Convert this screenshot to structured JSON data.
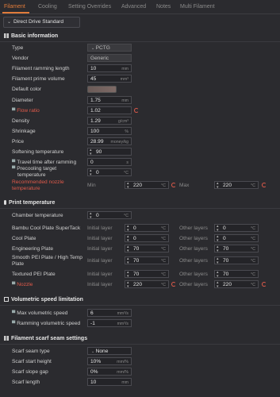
{
  "tabs": [
    "Filament",
    "Cooling",
    "Setting Overrides",
    "Advanced",
    "Notes",
    "Multi Filament"
  ],
  "preset": "Direct Drive Standard",
  "sections": {
    "basic": "Basic information",
    "print_temp": "Print temperature",
    "volumetric": "Volumetric speed limitation",
    "scarf": "Filament scarf seam settings"
  },
  "basic": {
    "type_label": "Type",
    "type_value": "PCTG",
    "vendor_label": "Vendor",
    "vendor_value": "Generic",
    "ramming_label": "Filament ramming length",
    "ramming_value": "10",
    "ramming_unit": "mm",
    "prime_label": "Filament prime volume",
    "prime_value": "45",
    "prime_unit": "mm³",
    "color_label": "Default color",
    "diameter_label": "Diameter",
    "diameter_value": "1.75",
    "diameter_unit": "mm",
    "flow_label": "Flow ratio",
    "flow_value": "1.02",
    "density_label": "Density",
    "density_value": "1.29",
    "density_unit": "g/cm³",
    "shrinkage_label": "Shrinkage",
    "shrinkage_value": "100",
    "shrinkage_unit": "%",
    "price_label": "Price",
    "price_value": "28.99",
    "price_unit": "money/kg",
    "soften_label": "Softening temperature",
    "soften_value": "90",
    "travel_label": "Travel time after ramming",
    "travel_value": "0",
    "travel_unit": "s",
    "precool_label_1": "Precooling target",
    "precool_label_2": "temperature",
    "precool_value": "0",
    "precool_unit": "°C",
    "nozzle_label_1": "Recommended nozzle",
    "nozzle_label_2": "temperature",
    "min_label": "Min",
    "min_value": "220",
    "min_unit": "°C",
    "max_label": "Max",
    "max_value": "220",
    "max_unit": "°C"
  },
  "temps": {
    "chamber_label": "Chamber temperature",
    "chamber_value": "0",
    "chamber_unit": "°C",
    "initial": "Initial layer",
    "other": "Other layers",
    "unit": "°C",
    "rows": [
      {
        "label": "Bambu Cool Plate SuperTack",
        "initial": "0",
        "other": "0"
      },
      {
        "label": "Cool Plate",
        "initial": "0",
        "other": "0"
      },
      {
        "label": "Engineering Plate",
        "initial": "70",
        "other": "70"
      },
      {
        "label": "Smooth PEI Plate / High Temp",
        "label2": "Plate",
        "initial": "70",
        "other": "70"
      },
      {
        "label": "Textured PEI Plate",
        "initial": "70",
        "other": "70"
      },
      {
        "label": "Nozzle",
        "initial": "220",
        "other": "220"
      }
    ]
  },
  "volumetric": {
    "max_label": "Max volumetric speed",
    "max_value": "6",
    "max_unit": "mm³/s",
    "ram_label": "Ramming volumetric speed",
    "ram_value": "-1",
    "ram_unit": "mm³/s"
  },
  "scarf": {
    "type_label": "Scarf seam type",
    "type_value": "None",
    "height_label": "Scarf start height",
    "height_value": "10%",
    "height_unit": "mm/%",
    "gap_label": "Scarf slope gap",
    "gap_value": "0%",
    "gap_unit": "mm/%",
    "length_label": "Scarf length",
    "length_value": "10",
    "length_unit": "mm"
  }
}
